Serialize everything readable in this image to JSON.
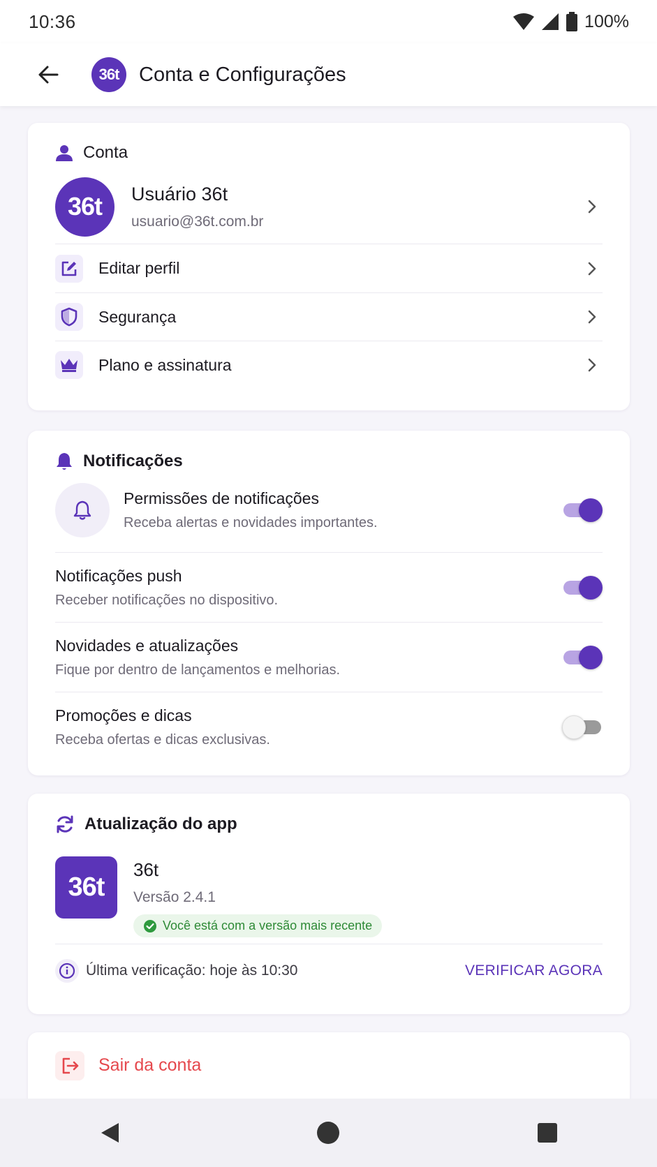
{
  "status": {
    "time": "10:36",
    "battery": "100%"
  },
  "appbar": {
    "logo": "36t",
    "title": "Conta e Configurações"
  },
  "account": {
    "header": "Conta",
    "user": {
      "avatar": "36t",
      "name": "Usuário 36t",
      "email": "usuario@36t.com.br"
    },
    "items": [
      {
        "label": "Editar perfil",
        "icon": "edit-icon"
      },
      {
        "label": "Segurança",
        "icon": "shield-icon"
      },
      {
        "label": "Plano e assinatura",
        "icon": "crown-icon"
      }
    ]
  },
  "notifications": {
    "header": "Notificações",
    "permissions": {
      "title": "Permissões de notificações",
      "subtitle": "Receba alertas e novidades importantes.",
      "enabled": true
    },
    "items": [
      {
        "title": "Notificações push",
        "subtitle": "Receber notificações no dispositivo.",
        "enabled": true
      },
      {
        "title": "Novidades e atualizações",
        "subtitle": "Fique por dentro de lançamentos e melhorias.",
        "enabled": true
      },
      {
        "title": "Promoções e dicas",
        "subtitle": "Receba ofertas e dicas exclusivas.",
        "enabled": false
      }
    ]
  },
  "update": {
    "header": "Atualização do app",
    "app_logo": "36t",
    "app_name": "36t",
    "version": "Versão 2.4.1",
    "status": "Você está com a versão mais recente",
    "last_check": "Última verificação: hoje às 10:30",
    "check_now": "VERIFICAR AGORA"
  },
  "logout": {
    "label": "Sair da conta"
  },
  "colors": {
    "primary": "#5b34b8",
    "danger": "#e5484d",
    "success": "#2e9a3e"
  }
}
